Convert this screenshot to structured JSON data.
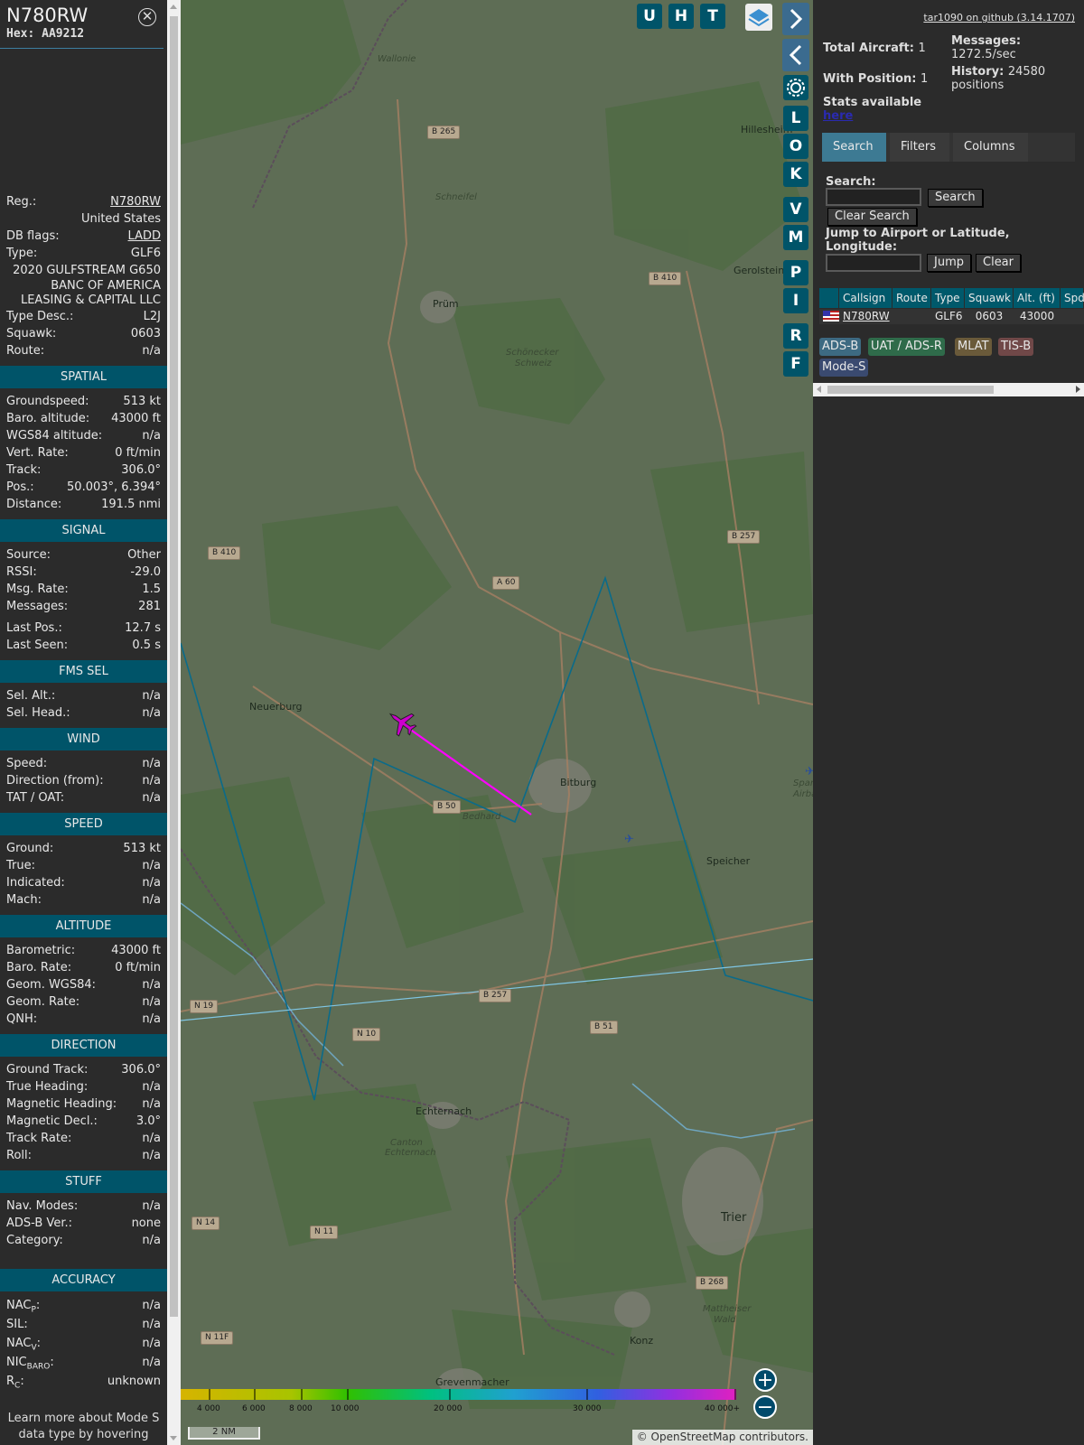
{
  "aircraft": {
    "callsign": "N780RW",
    "hex_label": "Hex:",
    "hex": "AA9212",
    "reg_label": "Reg.:",
    "reg": "N780RW",
    "country": "United States",
    "dbflags_label": "DB flags:",
    "dbflags": "LADD",
    "type_label": "Type:",
    "type": "GLF6",
    "model": "2020 GULFSTREAM G650",
    "owner_line1": "BANC OF AMERICA",
    "owner_line2": "LEASING & CAPITAL LLC",
    "typedesc_label": "Type Desc.:",
    "typedesc": "L2J",
    "squawk_label": "Squawk:",
    "squawk": "0603",
    "route_label": "Route:",
    "route": "n/a"
  },
  "sections": {
    "spatial": {
      "title": "SPATIAL",
      "rows": [
        {
          "label": "Groundspeed:",
          "value": "513 kt"
        },
        {
          "label": "Baro. altitude:",
          "value": "43000 ft"
        },
        {
          "label": "WGS84 altitude:",
          "value": "n/a"
        },
        {
          "label": "Vert. Rate:",
          "value": "0 ft/min"
        },
        {
          "label": "Track:",
          "value": "306.0°"
        },
        {
          "label": "Pos.:",
          "value": "50.003°, 6.394°"
        },
        {
          "label": "Distance:",
          "value": "191.5 nmi"
        }
      ]
    },
    "signal": {
      "title": "SIGNAL",
      "rows": [
        {
          "label": "Source:",
          "value": "Other"
        },
        {
          "label": "RSSI:",
          "value": "-29.0"
        },
        {
          "label": "Msg. Rate:",
          "value": "1.5"
        },
        {
          "label": "Messages:",
          "value": "281"
        }
      ],
      "rows2": [
        {
          "label": "Last Pos.:",
          "value": "12.7 s"
        },
        {
          "label": "Last Seen:",
          "value": "0.5 s"
        }
      ]
    },
    "fms": {
      "title": "FMS SEL",
      "rows": [
        {
          "label": "Sel. Alt.:",
          "value": "n/a"
        },
        {
          "label": "Sel. Head.:",
          "value": "n/a"
        }
      ]
    },
    "wind": {
      "title": "WIND",
      "rows": [
        {
          "label": "Speed:",
          "value": "n/a"
        },
        {
          "label": "Direction (from):",
          "value": "n/a"
        },
        {
          "label": "TAT / OAT:",
          "value": "n/a"
        }
      ]
    },
    "speed": {
      "title": "SPEED",
      "rows": [
        {
          "label": "Ground:",
          "value": "513 kt"
        },
        {
          "label": "True:",
          "value": "n/a"
        },
        {
          "label": "Indicated:",
          "value": "n/a"
        },
        {
          "label": "Mach:",
          "value": "n/a"
        }
      ]
    },
    "altitude": {
      "title": "ALTITUDE",
      "rows": [
        {
          "label": "Barometric:",
          "value": "43000 ft"
        },
        {
          "label": "Baro. Rate:",
          "value": "0 ft/min"
        },
        {
          "label": "Geom. WGS84:",
          "value": "n/a"
        },
        {
          "label": "Geom. Rate:",
          "value": "n/a"
        },
        {
          "label": "QNH:",
          "value": "n/a"
        }
      ]
    },
    "direction": {
      "title": "DIRECTION",
      "rows": [
        {
          "label": "Ground Track:",
          "value": "306.0°"
        },
        {
          "label": "True Heading:",
          "value": "n/a"
        },
        {
          "label": "Magnetic Heading:",
          "value": "n/a"
        },
        {
          "label": "Magnetic Decl.:",
          "value": "3.0°"
        },
        {
          "label": "Track Rate:",
          "value": "n/a"
        },
        {
          "label": "Roll:",
          "value": "n/a"
        }
      ]
    },
    "stuff": {
      "title": "STUFF",
      "rows": [
        {
          "label": "Nav. Modes:",
          "value": "n/a"
        },
        {
          "label": "ADS-B Ver.:",
          "value": "none"
        },
        {
          "label": "Category:",
          "value": "n/a"
        }
      ]
    },
    "accuracy": {
      "title": "ACCURACY",
      "nacp_base": "NAC",
      "nacp_sub": "P",
      "nacp_value": "n/a",
      "sil_label": "SIL:",
      "sil_value": "n/a",
      "nacv_base": "NAC",
      "nacv_sub": "V",
      "nacv_value": "n/a",
      "nic_base": "NIC",
      "nic_sub": "BARO",
      "nic_value": "n/a",
      "rc_base": "R",
      "rc_sub": "C",
      "rc_value": "unknown"
    },
    "note": "Learn more about Mode S data type by hovering over each data label."
  },
  "map": {
    "buttons": [
      "U",
      "H",
      "T"
    ],
    "side_buttons": [
      "L",
      "O",
      "K",
      "V",
      "M",
      "P",
      "I",
      "R",
      "F"
    ],
    "places": {
      "wallonie": "Wallonie",
      "hillesheim": "Hillesheim",
      "schneifel": "Schneifel",
      "gerolstein": "Gerolstein",
      "prum": "Prüm",
      "schonecker1": "Schönecker",
      "schonecker2": "Schweiz",
      "neuerburg": "Neuerburg",
      "bitburg": "Bitburg",
      "bedhard": "Bedhard",
      "speicher": "Speicher",
      "spangdahlem1": "Spangd",
      "spangdahlem2": "Airba",
      "echternach": "Echternach",
      "canton1": "Canton",
      "canton2": "Echternach",
      "trier": "Trier",
      "konz": "Konz",
      "grevenmacher": "Grevenmacher",
      "mattheiser1": "Mattheiser",
      "mattheiser2": "Wald"
    },
    "roads": {
      "b265": "B 265",
      "b410a": "B 410",
      "b410b": "B 410",
      "b257a": "B 257",
      "a60": "A 60",
      "b50": "B 50",
      "b257b": "B 257",
      "b51": "B 51",
      "n19": "N 19",
      "n10": "N 10",
      "n14": "N 14",
      "n11": "N 11",
      "n11f": "N 11F",
      "b268": "B 268"
    },
    "altitude_legend": [
      "4 000",
      "6 000",
      "8 000",
      "10 000",
      "20 000",
      "30 000",
      "40 000+"
    ],
    "scale": "2 NM",
    "attribution": "© OpenStreetMap contributors.",
    "colors": {
      "track": "#ff00ff",
      "aircraft": "#cc00cc",
      "range_ring": "#0a6b8a",
      "accent": "#005469"
    }
  },
  "right": {
    "version": "tar1090 on github (3.14.1707)",
    "total_label": "Total Aircraft:",
    "total": "1",
    "with_pos_label": "With Position:",
    "with_pos": "1",
    "stats_label": "Stats available",
    "stats_link": "here",
    "messages_label": "Messages:",
    "messages": "1272.5/sec",
    "history_label": "History:",
    "history": "24580",
    "history_unit": "positions",
    "tabs": [
      "Search",
      "Filters",
      "Columns"
    ],
    "search_label": "Search:",
    "search_button": "Search",
    "clear_search": "Clear Search",
    "jump_label1": "Jump to Airport or Latitude,",
    "jump_label2": "Longitude:",
    "jump_button": "Jump",
    "clear_button": "Clear",
    "columns": [
      "Callsign",
      "Route",
      "Type",
      "Squawk",
      "Alt. (ft)",
      "Spd"
    ],
    "row": {
      "callsign": "N780RW",
      "route": "",
      "type": "GLF6",
      "squawk": "0603",
      "alt": "43000"
    },
    "sources": [
      "ADS-B",
      "UAT / ADS-R",
      "MLAT",
      "TIS-B",
      "Mode-S"
    ]
  }
}
